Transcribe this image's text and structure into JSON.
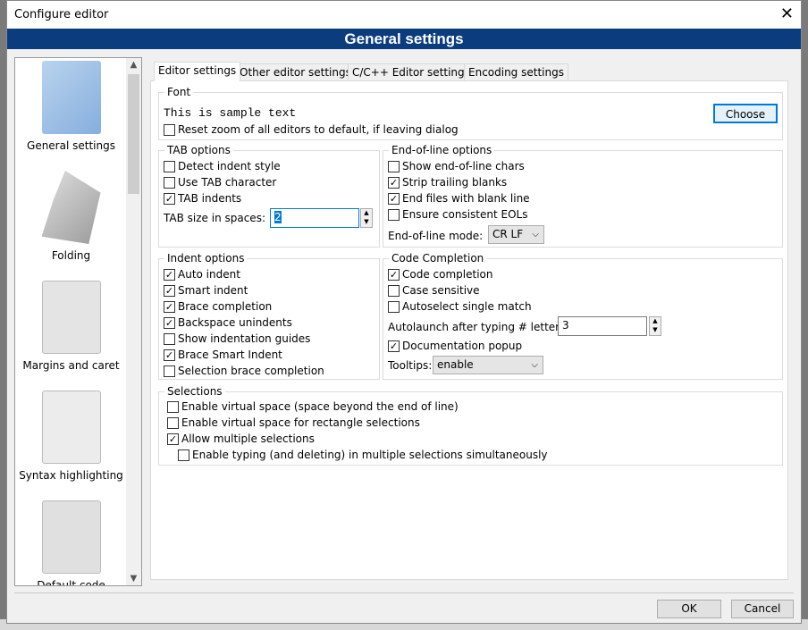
{
  "window": {
    "title": "Configure editor",
    "close": "✕"
  },
  "banner": "General settings",
  "sidebar": {
    "items": [
      {
        "label": "General settings",
        "icon": "document-pencil-icon",
        "color": "#9fc1e3"
      },
      {
        "label": "Folding",
        "icon": "origami-icon",
        "color": "#bfbfbf"
      },
      {
        "label": "Margins and caret",
        "icon": "pages-icon",
        "color": "#d8d8d8"
      },
      {
        "label": "Syntax highlighting",
        "icon": "lightbulb-page-icon",
        "color": "#e0e0e0"
      },
      {
        "label": "Default code",
        "icon": "stamp-icon",
        "color": "#c8c8c8"
      }
    ]
  },
  "tabs": [
    "Editor settings",
    "Other editor settings",
    "C/C++ Editor settings",
    "Encoding settings"
  ],
  "font": {
    "label": "Font",
    "sample": "This is sample text",
    "reset": {
      "label": "Reset zoom of all editors to default, if leaving dialog",
      "checked": false
    },
    "choose": "Choose"
  },
  "tab_options": {
    "label": "TAB options",
    "items": [
      {
        "label": "Detect indent style",
        "checked": false
      },
      {
        "label": "Use TAB character",
        "checked": false
      },
      {
        "label": "TAB indents",
        "checked": true
      }
    ],
    "size_label": "TAB size in spaces:",
    "size_value": "2"
  },
  "eol": {
    "label": "End-of-line options",
    "items": [
      {
        "label": "Show end-of-line chars",
        "checked": false
      },
      {
        "label": "Strip trailing blanks",
        "checked": true
      },
      {
        "label": "End files with blank line",
        "checked": true
      },
      {
        "label": "Ensure consistent EOLs",
        "checked": false
      }
    ],
    "mode_label": "End-of-line mode:",
    "mode_value": "CR LF"
  },
  "indent": {
    "label": "Indent options",
    "items": [
      {
        "label": "Auto indent",
        "checked": true
      },
      {
        "label": "Smart indent",
        "checked": true
      },
      {
        "label": "Brace completion",
        "checked": true
      },
      {
        "label": "Backspace unindents",
        "checked": true
      },
      {
        "label": "Show indentation guides",
        "checked": false
      },
      {
        "label": "Brace Smart Indent",
        "checked": true
      },
      {
        "label": "Selection brace completion",
        "checked": false
      }
    ]
  },
  "cc": {
    "label": "Code Completion",
    "items": [
      {
        "label": "Code completion",
        "checked": true
      },
      {
        "label": "Case sensitive",
        "checked": false
      },
      {
        "label": "Autoselect single match",
        "checked": false
      }
    ],
    "autolaunch_label": "Autolaunch after typing # letters:",
    "autolaunch_value": "3",
    "docpopup": {
      "label": "Documentation popup",
      "checked": true
    },
    "tooltips_label": "Tooltips:",
    "tooltips_value": "enable"
  },
  "selections": {
    "label": "Selections",
    "items": [
      {
        "label": "Enable virtual space (space beyond the end of line)",
        "checked": false
      },
      {
        "label": "Enable virtual space for rectangle selections",
        "checked": false
      },
      {
        "label": "Allow multiple selections",
        "checked": true
      },
      {
        "label": "Enable typing (and deleting) in multiple selections simultaneously",
        "checked": false
      }
    ]
  },
  "buttons": {
    "ok": "OK",
    "cancel": "Cancel"
  },
  "check_glyph": "✓"
}
